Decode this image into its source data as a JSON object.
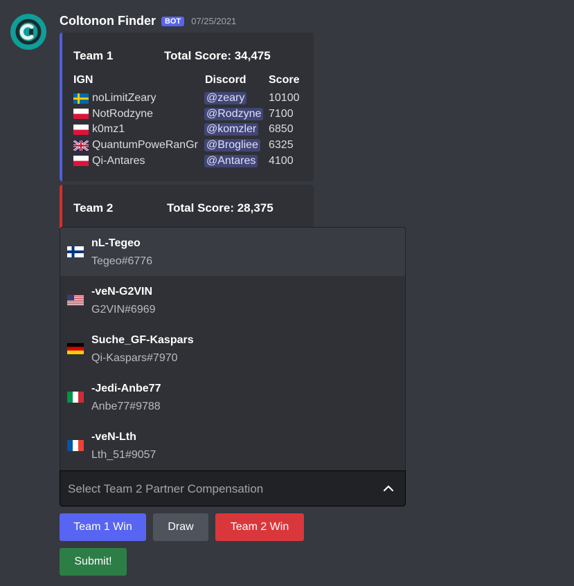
{
  "message": {
    "username": "Coltonon Finder",
    "bot_badge": "BOT",
    "timestamp": "07/25/2021",
    "avatar_color": "#0f9e9a"
  },
  "team1": {
    "name": "Team 1",
    "total": "Total Score: 34,475",
    "accent": "#4e5fdc",
    "headers": {
      "ign": "IGN",
      "discord": "Discord",
      "score": "Score"
    },
    "players": [
      {
        "flag": "se",
        "ign": "noLimitZeary",
        "discord": "@zeary",
        "score": "10100"
      },
      {
        "flag": "pl",
        "ign": "NotRodzyne",
        "discord": "@Rodzyne",
        "score": "7100"
      },
      {
        "flag": "pl",
        "ign": "k0mz1",
        "discord": "@komzler",
        "score": "6850"
      },
      {
        "flag": "gb",
        "ign": "QuantumPoweRanGr",
        "discord": "@Brogliee",
        "score": "6325"
      },
      {
        "flag": "pl",
        "ign": "Qi-Antares",
        "discord": "@Antares",
        "score": "4100"
      }
    ]
  },
  "team2": {
    "name": "Team 2",
    "total": "Total Score: 28,375",
    "accent": "#d72d2d"
  },
  "dropdown": {
    "options": [
      {
        "flag": "fi",
        "label": "nL-Tegeo",
        "description": "Tegeo#6776"
      },
      {
        "flag": "us",
        "label": "-veN-G2VIN",
        "description": "G2VIN#6969"
      },
      {
        "flag": "de",
        "label": "Suche_GF-Kaspars",
        "description": "Qi-Kaspars#7970"
      },
      {
        "flag": "it",
        "label": "-Jedi-Anbe77",
        "description": "Anbe77#9788"
      },
      {
        "flag": "fr",
        "label": "-veN-Lth",
        "description": "Lth_51#9057"
      }
    ],
    "placeholder": "Select Team 2 Partner Compensation"
  },
  "buttons": {
    "team1_win": "Team 1 Win",
    "draw": "Draw",
    "team2_win": "Team 2 Win",
    "submit": "Submit!"
  }
}
